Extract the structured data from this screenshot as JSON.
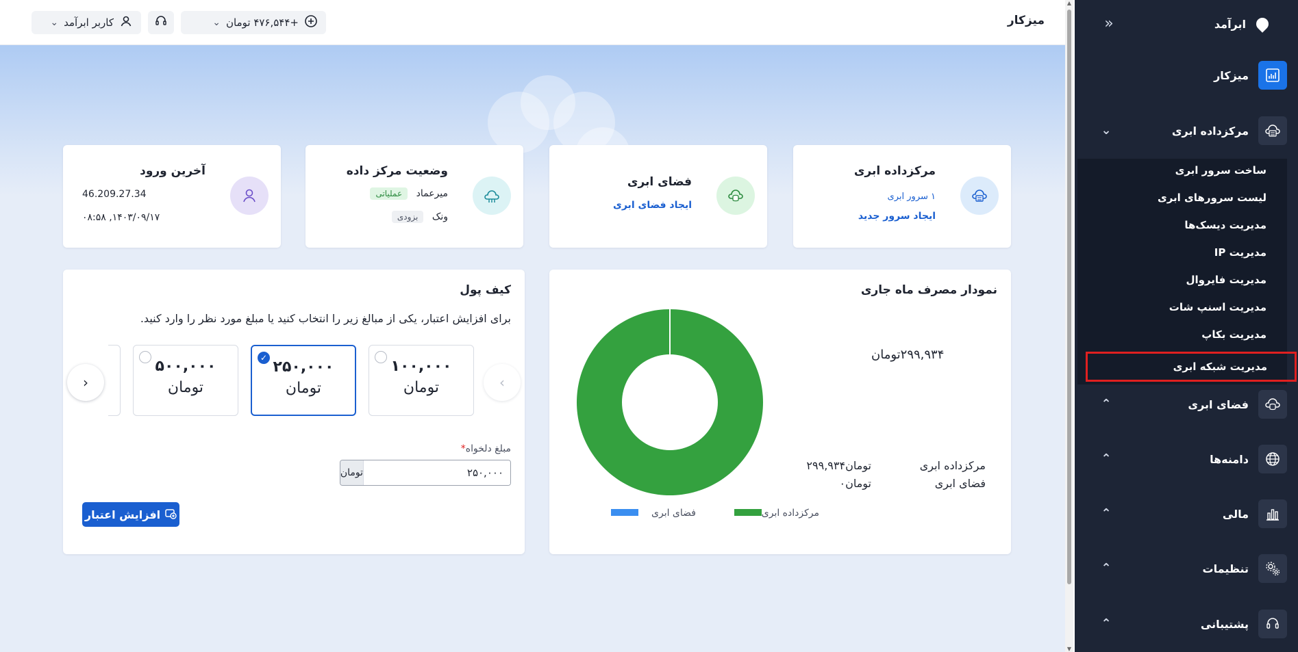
{
  "topbar": {
    "page_title": "میزکار",
    "user_label": "کاربر ابرآمد",
    "balance_label": "+۴۷۶,۵۴۴ تومان",
    "support_icon": "headset-icon"
  },
  "sidebar": {
    "brand": "ابرآمد",
    "items": [
      {
        "label": "میزکار",
        "icon": "dashboard-chart-icon",
        "active": true
      },
      {
        "label": "مرکزداده ابری",
        "icon": "cloud-server-icon",
        "expanded": true
      },
      {
        "label": "فضای ابری",
        "icon": "cloud-storage-icon"
      },
      {
        "label": "دامنه‌ها",
        "icon": "globe-icon"
      },
      {
        "label": "مالی",
        "icon": "bar-chart-icon"
      },
      {
        "label": "تنظیمات",
        "icon": "gears-icon"
      },
      {
        "label": "پشتیبانی",
        "icon": "headset-icon"
      }
    ],
    "submenu": [
      "ساخت سرور ابری",
      "لیست سرورهای ابری",
      "مدیریت دیسک‌ها",
      "مدیریت IP",
      "مدیریت فایروال",
      "مدیریت اسنپ شات",
      "مدیریت بکاپ",
      "مدیریت شبکه ابری"
    ]
  },
  "cards": {
    "datacenter": {
      "title": "مرکزداده ابری",
      "servers": "۱ سرور ابری",
      "link": "ایجاد سرور جدید"
    },
    "storage": {
      "title": "فضای ابری",
      "link": "ایجاد فضای ابری"
    },
    "dc_status": {
      "title": "وضعیت مرکز داده",
      "dc1": "میرعماد",
      "dc1_status": "عملیاتی",
      "dc2": "ونک",
      "dc2_status": "بزودی"
    },
    "last_login": {
      "title": "آخرین ورود",
      "ip": "46.209.27.34",
      "datetime": "۱۴۰۳/۰۹/۱۷, ۰۸:۵۸"
    }
  },
  "chart_card": {
    "title": "نمودار مصرف ماه جاری",
    "total_label": "۲۹۹,۹۳۴تومان",
    "rows": [
      {
        "name": "مرکزداده ابری",
        "value": "۲۹۹,۹۳۴تومان"
      },
      {
        "name": "فضای ابری",
        "value": "۰تومان"
      }
    ]
  },
  "chart_data": {
    "type": "pie",
    "title": "نمودار مصرف ماه جاری",
    "categories": [
      "مرکزداده ابری",
      "فضای ابری"
    ],
    "values": [
      299934,
      0
    ],
    "colors": [
      "#34a13f",
      "#3a8ef0"
    ],
    "legend": "bottom"
  },
  "wallet": {
    "title": "کیف پول",
    "description": "برای افزایش اعتبار، یکی از مبالغ زیر را انتخاب کنید یا مبلغ مورد نظر را وارد کنید.",
    "options": [
      {
        "amount": "۱۰۰,۰۰۰",
        "unit": "تومان",
        "selected": false
      },
      {
        "amount": "۲۵۰,۰۰۰",
        "unit": "تومان",
        "selected": true
      },
      {
        "amount": "۵۰۰,۰۰۰",
        "unit": "تومان",
        "selected": false
      }
    ],
    "field_label": "مبلغ دلخواه",
    "field_required": "*",
    "field_value": "۲۵۰,۰۰۰",
    "field_unit": "تومان",
    "button_label": "افزایش اعتبار"
  },
  "colors": {
    "sidebar_bg": "#1d2536",
    "accent": "#1a5fd0",
    "chart_green": "#34a13f",
    "chart_blue": "#3a8ef0",
    "highlight": "#e02020"
  }
}
